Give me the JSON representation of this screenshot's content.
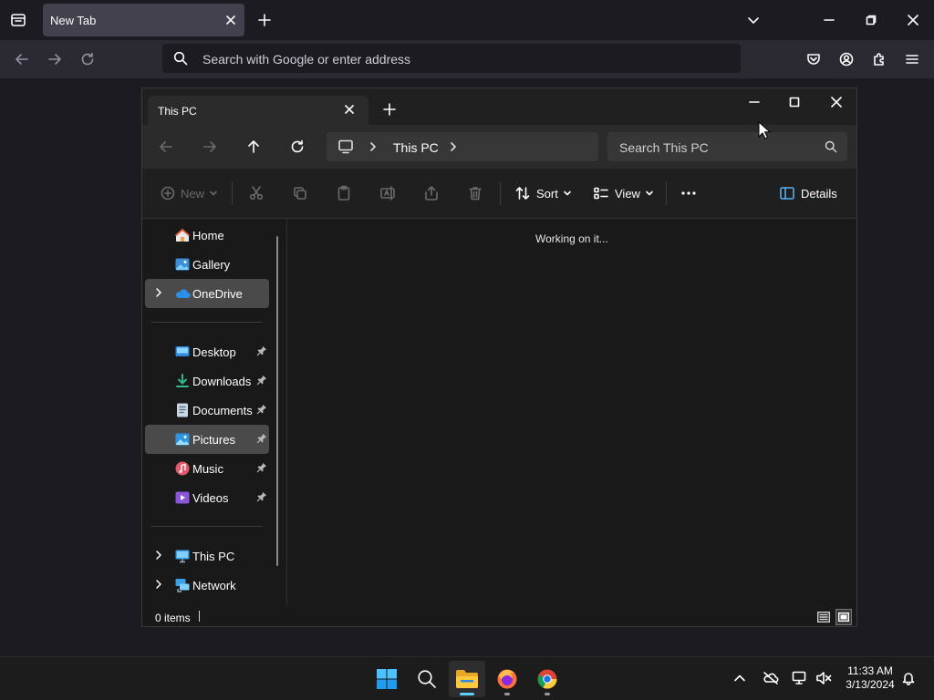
{
  "browser": {
    "tab_title": "New Tab",
    "url_placeholder": "Search with Google or enter address"
  },
  "explorer": {
    "tab_title": "This PC",
    "address": "This PC",
    "search_placeholder": "Search This PC",
    "commands": {
      "new": "New",
      "sort": "Sort",
      "view": "View",
      "details": "Details"
    },
    "sidebar": {
      "items": [
        {
          "label": "Home",
          "icon": "home-icon"
        },
        {
          "label": "Gallery",
          "icon": "gallery-icon"
        },
        {
          "label": "OneDrive",
          "icon": "onedrive-icon"
        },
        {
          "label": "Desktop",
          "icon": "desktop-folder-icon"
        },
        {
          "label": "Downloads",
          "icon": "downloads-folder-icon"
        },
        {
          "label": "Documents",
          "icon": "documents-folder-icon"
        },
        {
          "label": "Pictures",
          "icon": "pictures-folder-icon"
        },
        {
          "label": "Music",
          "icon": "music-folder-icon"
        },
        {
          "label": "Videos",
          "icon": "videos-folder-icon"
        },
        {
          "label": "This PC",
          "icon": "this-pc-icon"
        },
        {
          "label": "Network",
          "icon": "network-icon"
        }
      ]
    },
    "content_status": "Working on it...",
    "status_bar": {
      "items_count": "0 items"
    }
  },
  "taskbar": {
    "time": "11:33 AM",
    "date": "3/13/2024"
  },
  "colors": {
    "accent": "#0078d4",
    "onedrive_blue": "#2b8fe8",
    "firefox_orange": "#ff7139"
  }
}
